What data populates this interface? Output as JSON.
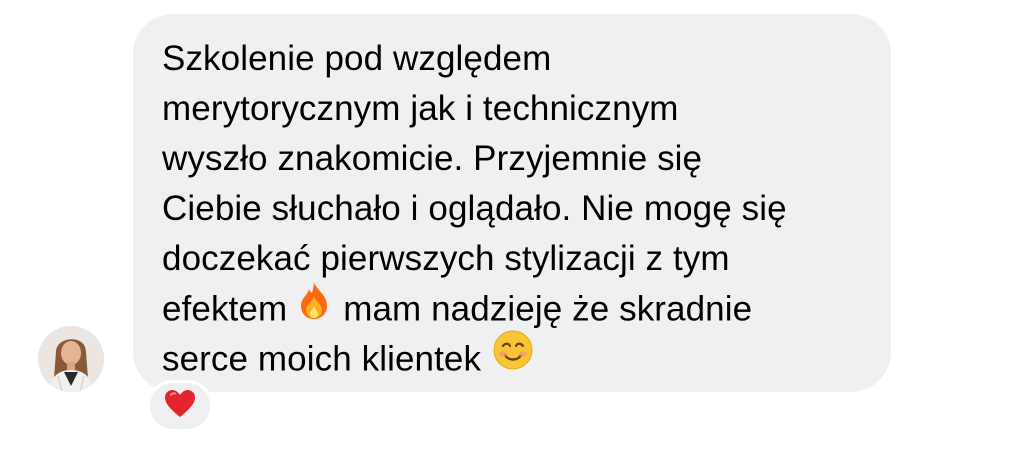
{
  "message": {
    "lines": [
      "Szkolenie pod względem",
      "merytorycznym jak i technicznym",
      "wyszło znakomicie. Przyjemnie się",
      "Ciebie słuchało i oglądało. Nie mogę się",
      "doczekać pierwszych stylizacji z tym",
      "efektem",
      "mam nadzieję że skradnie",
      "serce moich klientek"
    ],
    "emojis": [
      "fire",
      "smiling-face"
    ]
  },
  "reaction": {
    "emoji": "red-heart"
  },
  "avatar": {
    "icon": "user-avatar"
  },
  "colors": {
    "bubble": "#f0f0f2",
    "text": "#000000",
    "heart": "#e5252d",
    "fire": "#ff7a12",
    "smile": "#f7c337"
  }
}
